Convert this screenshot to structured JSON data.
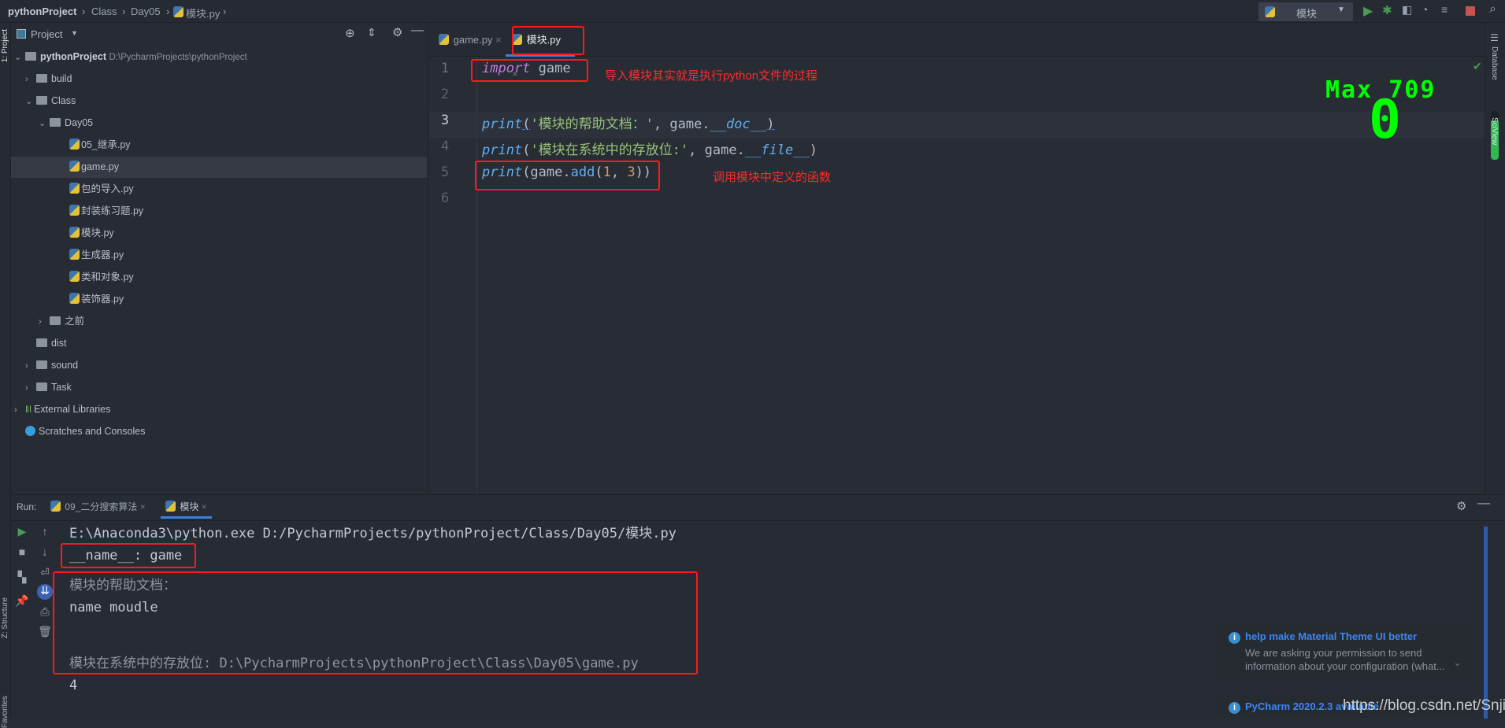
{
  "breadcrumb": [
    "pythonProject",
    "Class",
    "Day05",
    "模块.py"
  ],
  "run_config": {
    "label": "模块"
  },
  "toolbar_icons": [
    "run-icon",
    "debug-icon",
    "coverage-icon",
    "profile-icon",
    "concurrency-icon",
    "stop-icon",
    "search-icon"
  ],
  "left_strip": {
    "project": "1: Project",
    "structure": "Z: Structure",
    "favorites": "Favorites"
  },
  "right_strip": {
    "database": "Database",
    "sciview": "SciView"
  },
  "project_panel": {
    "title": "Project",
    "tree": [
      {
        "label": "pythonProject",
        "path": "D:\\PycharmProjects\\pythonProject",
        "type": "folder",
        "expanded": true
      },
      {
        "label": "build",
        "type": "folder",
        "expanded": false
      },
      {
        "label": "Class",
        "type": "folder",
        "expanded": true
      },
      {
        "label": "Day05",
        "type": "folder",
        "expanded": true
      },
      {
        "label": "05_继承.py",
        "type": "py"
      },
      {
        "label": "game.py",
        "type": "py",
        "selected": true
      },
      {
        "label": "包的导入.py",
        "type": "py"
      },
      {
        "label": "封装练习题.py",
        "type": "py"
      },
      {
        "label": "模块.py",
        "type": "py"
      },
      {
        "label": "生成器.py",
        "type": "py"
      },
      {
        "label": "类和对象.py",
        "type": "py"
      },
      {
        "label": "装饰器.py",
        "type": "py"
      },
      {
        "label": "之前",
        "type": "folder",
        "expanded": false
      },
      {
        "label": "dist",
        "type": "folder"
      },
      {
        "label": "sound",
        "type": "folder",
        "expanded": false
      },
      {
        "label": "Task",
        "type": "folder",
        "expanded": false
      },
      {
        "label": "External Libraries",
        "type": "libs"
      },
      {
        "label": "Scratches and Consoles",
        "type": "scratch"
      }
    ]
  },
  "editor": {
    "tabs": [
      {
        "label": "game.py",
        "active": false
      },
      {
        "label": "模块.py",
        "active": true
      }
    ],
    "line_numbers": [
      "1",
      "2",
      "3",
      "4",
      "5",
      "6"
    ],
    "code": {
      "l1_kw": "import",
      "l1_rest": " game",
      "l3_fn": "print",
      "l3_a": "(",
      "l3_str": "'模块的帮助文档：'",
      "l3_b": ", game.",
      "l3_attr": "__doc__",
      "l3_c": ")",
      "l4_fn": "print",
      "l4_a": "(",
      "l4_str": "'模块在系统中的存放位:'",
      "l4_b": ", game.",
      "l4_attr": "__file__",
      "l4_c": ")",
      "l5_fn": "print",
      "l5_a": "(game.",
      "l5_method": "add",
      "l5_b": "(",
      "l5_n1": "1",
      "l5_c": ", ",
      "l5_n2": "3",
      "l5_d": "))"
    },
    "annotations": [
      "导入模块其实就是执行python文件的过程",
      "调用模块中定义的函数"
    ],
    "overlay": {
      "max_label": "Max 709",
      "score": "0",
      "color": "#00ff00"
    }
  },
  "run_panel": {
    "label": "Run:",
    "tabs": [
      {
        "label": "09_二分搜索算法",
        "active": false
      },
      {
        "label": "模块",
        "active": true
      }
    ],
    "output": [
      "E:\\Anaconda3\\python.exe D:/PycharmProjects/pythonProject/Class/Day05/模块.py",
      "__name__: game",
      "模块的帮助文档：",
      "name moudle",
      "",
      "模块在系统中的存放位: D:\\PycharmProjects\\pythonProject\\Class\\Day05\\game.py",
      "4"
    ]
  },
  "notifications": [
    {
      "title": "help make Material Theme UI better",
      "body": "We are asking your permission to send information about your configuration (what..."
    },
    {
      "title": "PyCharm 2020.2.3 available"
    }
  ],
  "watermark": "https://blog.csdn.net/Snji_G",
  "colors": {
    "annotation_red": "#ff1a1a",
    "accent": "#3d7ee0",
    "run_green": "#499c54",
    "stop_red": "#c75450"
  }
}
